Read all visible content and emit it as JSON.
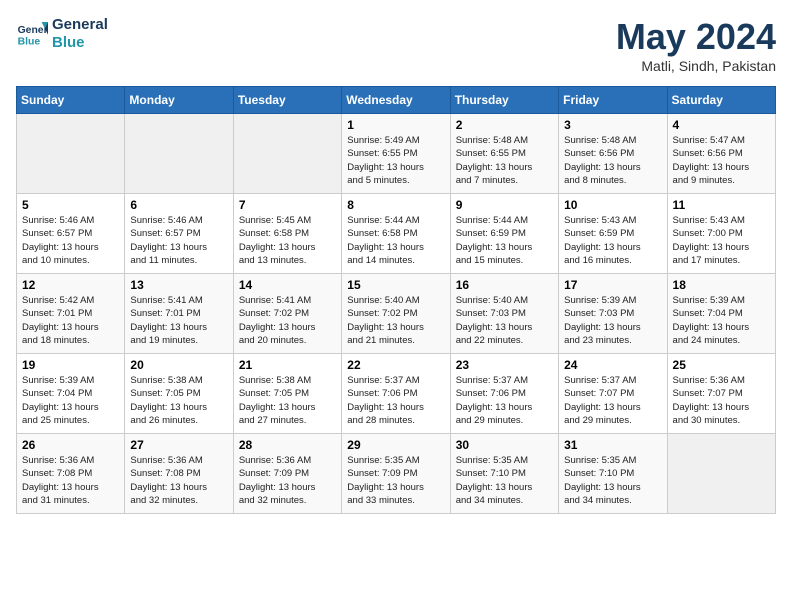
{
  "logo": {
    "line1": "General",
    "line2": "Blue"
  },
  "title": "May 2024",
  "location": "Matli, Sindh, Pakistan",
  "weekdays": [
    "Sunday",
    "Monday",
    "Tuesday",
    "Wednesday",
    "Thursday",
    "Friday",
    "Saturday"
  ],
  "weeks": [
    [
      {
        "day": "",
        "info": ""
      },
      {
        "day": "",
        "info": ""
      },
      {
        "day": "",
        "info": ""
      },
      {
        "day": "1",
        "info": "Sunrise: 5:49 AM\nSunset: 6:55 PM\nDaylight: 13 hours\nand 5 minutes."
      },
      {
        "day": "2",
        "info": "Sunrise: 5:48 AM\nSunset: 6:55 PM\nDaylight: 13 hours\nand 7 minutes."
      },
      {
        "day": "3",
        "info": "Sunrise: 5:48 AM\nSunset: 6:56 PM\nDaylight: 13 hours\nand 8 minutes."
      },
      {
        "day": "4",
        "info": "Sunrise: 5:47 AM\nSunset: 6:56 PM\nDaylight: 13 hours\nand 9 minutes."
      }
    ],
    [
      {
        "day": "5",
        "info": "Sunrise: 5:46 AM\nSunset: 6:57 PM\nDaylight: 13 hours\nand 10 minutes."
      },
      {
        "day": "6",
        "info": "Sunrise: 5:46 AM\nSunset: 6:57 PM\nDaylight: 13 hours\nand 11 minutes."
      },
      {
        "day": "7",
        "info": "Sunrise: 5:45 AM\nSunset: 6:58 PM\nDaylight: 13 hours\nand 13 minutes."
      },
      {
        "day": "8",
        "info": "Sunrise: 5:44 AM\nSunset: 6:58 PM\nDaylight: 13 hours\nand 14 minutes."
      },
      {
        "day": "9",
        "info": "Sunrise: 5:44 AM\nSunset: 6:59 PM\nDaylight: 13 hours\nand 15 minutes."
      },
      {
        "day": "10",
        "info": "Sunrise: 5:43 AM\nSunset: 6:59 PM\nDaylight: 13 hours\nand 16 minutes."
      },
      {
        "day": "11",
        "info": "Sunrise: 5:43 AM\nSunset: 7:00 PM\nDaylight: 13 hours\nand 17 minutes."
      }
    ],
    [
      {
        "day": "12",
        "info": "Sunrise: 5:42 AM\nSunset: 7:01 PM\nDaylight: 13 hours\nand 18 minutes."
      },
      {
        "day": "13",
        "info": "Sunrise: 5:41 AM\nSunset: 7:01 PM\nDaylight: 13 hours\nand 19 minutes."
      },
      {
        "day": "14",
        "info": "Sunrise: 5:41 AM\nSunset: 7:02 PM\nDaylight: 13 hours\nand 20 minutes."
      },
      {
        "day": "15",
        "info": "Sunrise: 5:40 AM\nSunset: 7:02 PM\nDaylight: 13 hours\nand 21 minutes."
      },
      {
        "day": "16",
        "info": "Sunrise: 5:40 AM\nSunset: 7:03 PM\nDaylight: 13 hours\nand 22 minutes."
      },
      {
        "day": "17",
        "info": "Sunrise: 5:39 AM\nSunset: 7:03 PM\nDaylight: 13 hours\nand 23 minutes."
      },
      {
        "day": "18",
        "info": "Sunrise: 5:39 AM\nSunset: 7:04 PM\nDaylight: 13 hours\nand 24 minutes."
      }
    ],
    [
      {
        "day": "19",
        "info": "Sunrise: 5:39 AM\nSunset: 7:04 PM\nDaylight: 13 hours\nand 25 minutes."
      },
      {
        "day": "20",
        "info": "Sunrise: 5:38 AM\nSunset: 7:05 PM\nDaylight: 13 hours\nand 26 minutes."
      },
      {
        "day": "21",
        "info": "Sunrise: 5:38 AM\nSunset: 7:05 PM\nDaylight: 13 hours\nand 27 minutes."
      },
      {
        "day": "22",
        "info": "Sunrise: 5:37 AM\nSunset: 7:06 PM\nDaylight: 13 hours\nand 28 minutes."
      },
      {
        "day": "23",
        "info": "Sunrise: 5:37 AM\nSunset: 7:06 PM\nDaylight: 13 hours\nand 29 minutes."
      },
      {
        "day": "24",
        "info": "Sunrise: 5:37 AM\nSunset: 7:07 PM\nDaylight: 13 hours\nand 29 minutes."
      },
      {
        "day": "25",
        "info": "Sunrise: 5:36 AM\nSunset: 7:07 PM\nDaylight: 13 hours\nand 30 minutes."
      }
    ],
    [
      {
        "day": "26",
        "info": "Sunrise: 5:36 AM\nSunset: 7:08 PM\nDaylight: 13 hours\nand 31 minutes."
      },
      {
        "day": "27",
        "info": "Sunrise: 5:36 AM\nSunset: 7:08 PM\nDaylight: 13 hours\nand 32 minutes."
      },
      {
        "day": "28",
        "info": "Sunrise: 5:36 AM\nSunset: 7:09 PM\nDaylight: 13 hours\nand 32 minutes."
      },
      {
        "day": "29",
        "info": "Sunrise: 5:35 AM\nSunset: 7:09 PM\nDaylight: 13 hours\nand 33 minutes."
      },
      {
        "day": "30",
        "info": "Sunrise: 5:35 AM\nSunset: 7:10 PM\nDaylight: 13 hours\nand 34 minutes."
      },
      {
        "day": "31",
        "info": "Sunrise: 5:35 AM\nSunset: 7:10 PM\nDaylight: 13 hours\nand 34 minutes."
      },
      {
        "day": "",
        "info": ""
      }
    ]
  ]
}
